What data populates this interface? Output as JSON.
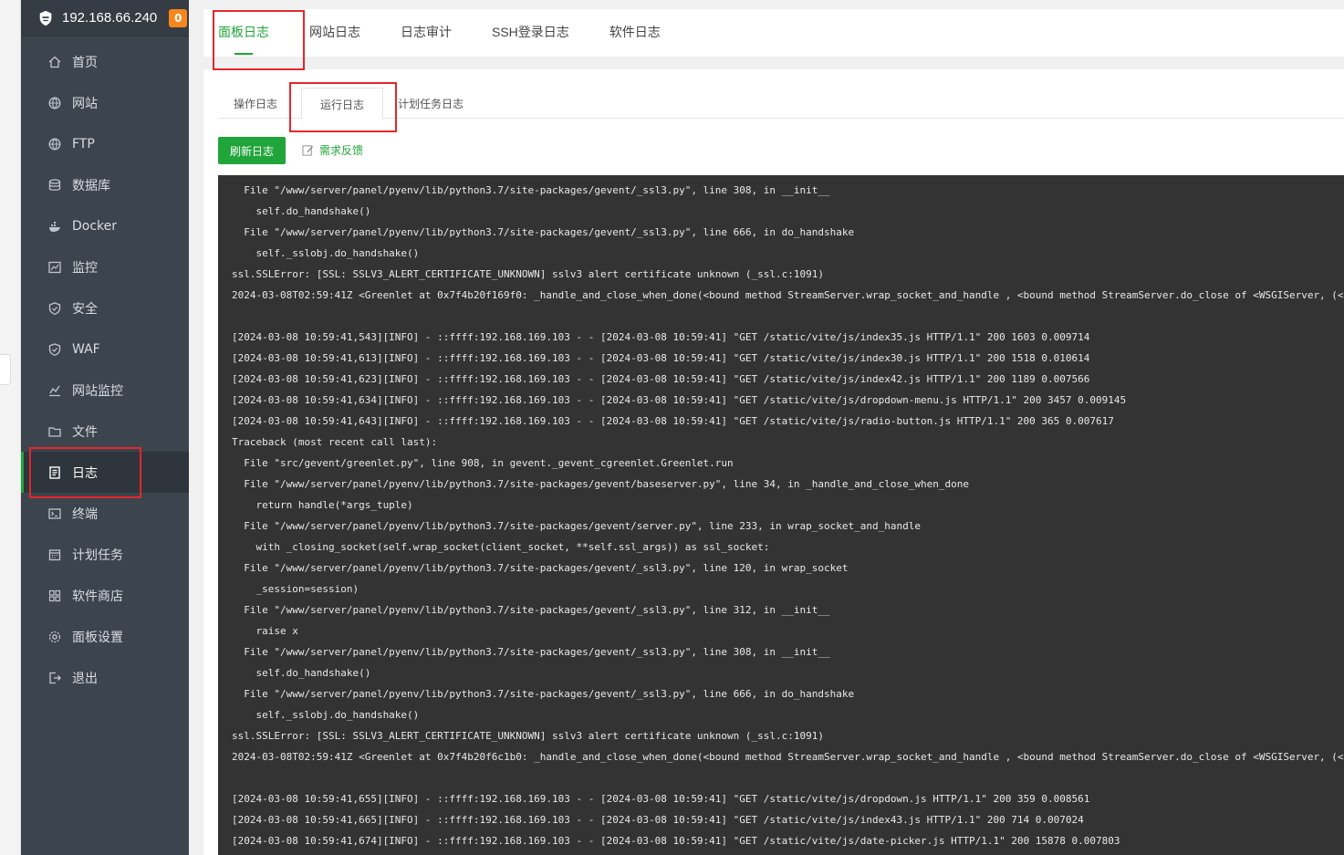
{
  "sidebar": {
    "server_ip": "192.168.66.240",
    "badge_count": "0",
    "items": [
      {
        "label": "首页",
        "icon": "home-icon"
      },
      {
        "label": "网站",
        "icon": "globe-icon"
      },
      {
        "label": "FTP",
        "icon": "globe-icon"
      },
      {
        "label": "数据库",
        "icon": "database-icon"
      },
      {
        "label": "Docker",
        "icon": "docker-icon"
      },
      {
        "label": "监控",
        "icon": "monitor-icon"
      },
      {
        "label": "安全",
        "icon": "shield-icon"
      },
      {
        "label": "WAF",
        "icon": "shield-icon"
      },
      {
        "label": "网站监控",
        "icon": "chart-icon"
      },
      {
        "label": "文件",
        "icon": "folder-icon"
      },
      {
        "label": "日志",
        "icon": "log-icon",
        "active": true
      },
      {
        "label": "终端",
        "icon": "terminal-icon"
      },
      {
        "label": "计划任务",
        "icon": "calendar-icon"
      },
      {
        "label": "软件商店",
        "icon": "apps-icon"
      },
      {
        "label": "面板设置",
        "icon": "gear-icon"
      },
      {
        "label": "退出",
        "icon": "logout-icon"
      }
    ]
  },
  "top_tabs": [
    "面板日志",
    "网站日志",
    "日志审计",
    "SSH登录日志",
    "软件日志"
  ],
  "sub_tabs": [
    "操作日志",
    "运行日志",
    "计划任务日志"
  ],
  "refresh_label": "刷新日志",
  "feedback_label": "需求反馈",
  "log_lines": [
    "  File \"/www/server/panel/pyenv/lib/python3.7/site-packages/gevent/_ssl3.py\", line 308, in __init__",
    "    self.do_handshake()",
    "  File \"/www/server/panel/pyenv/lib/python3.7/site-packages/gevent/_ssl3.py\", line 666, in do_handshake",
    "    self._sslobj.do_handshake()",
    "ssl.SSLError: [SSL: SSLV3_ALERT_CERTIFICATE_UNKNOWN] sslv3 alert certificate unknown (_ssl.c:1091)",
    "2024-03-08T02:59:41Z <Greenlet at 0x7f4b20f169f0: _handle_and_close_when_done(<bound method StreamServer.wrap_socket_and_handle , <bound method StreamServer.do_close of <WSGIServer, (<g",
    "",
    "[2024-03-08 10:59:41,543][INFO] - ::ffff:192.168.169.103 - - [2024-03-08 10:59:41] \"GET /static/vite/js/index35.js HTTP/1.1\" 200 1603 0.009714",
    "[2024-03-08 10:59:41,613][INFO] - ::ffff:192.168.169.103 - - [2024-03-08 10:59:41] \"GET /static/vite/js/index30.js HTTP/1.1\" 200 1518 0.010614",
    "[2024-03-08 10:59:41,623][INFO] - ::ffff:192.168.169.103 - - [2024-03-08 10:59:41] \"GET /static/vite/js/index42.js HTTP/1.1\" 200 1189 0.007566",
    "[2024-03-08 10:59:41,634][INFO] - ::ffff:192.168.169.103 - - [2024-03-08 10:59:41] \"GET /static/vite/js/dropdown-menu.js HTTP/1.1\" 200 3457 0.009145",
    "[2024-03-08 10:59:41,643][INFO] - ::ffff:192.168.169.103 - - [2024-03-08 10:59:41] \"GET /static/vite/js/radio-button.js HTTP/1.1\" 200 365 0.007617",
    "Traceback (most recent call last):",
    "  File \"src/gevent/greenlet.py\", line 908, in gevent._gevent_cgreenlet.Greenlet.run",
    "  File \"/www/server/panel/pyenv/lib/python3.7/site-packages/gevent/baseserver.py\", line 34, in _handle_and_close_when_done",
    "    return handle(*args_tuple)",
    "  File \"/www/server/panel/pyenv/lib/python3.7/site-packages/gevent/server.py\", line 233, in wrap_socket_and_handle",
    "    with _closing_socket(self.wrap_socket(client_socket, **self.ssl_args)) as ssl_socket:",
    "  File \"/www/server/panel/pyenv/lib/python3.7/site-packages/gevent/_ssl3.py\", line 120, in wrap_socket",
    "    _session=session)",
    "  File \"/www/server/panel/pyenv/lib/python3.7/site-packages/gevent/_ssl3.py\", line 312, in __init__",
    "    raise x",
    "  File \"/www/server/panel/pyenv/lib/python3.7/site-packages/gevent/_ssl3.py\", line 308, in __init__",
    "    self.do_handshake()",
    "  File \"/www/server/panel/pyenv/lib/python3.7/site-packages/gevent/_ssl3.py\", line 666, in do_handshake",
    "    self._sslobj.do_handshake()",
    "ssl.SSLError: [SSL: SSLV3_ALERT_CERTIFICATE_UNKNOWN] sslv3 alert certificate unknown (_ssl.c:1091)",
    "2024-03-08T02:59:41Z <Greenlet at 0x7f4b20f6c1b0: _handle_and_close_when_done(<bound method StreamServer.wrap_socket_and_handle , <bound method StreamServer.do_close of <WSGIServer, (<g",
    "",
    "[2024-03-08 10:59:41,655][INFO] - ::ffff:192.168.169.103 - - [2024-03-08 10:59:41] \"GET /static/vite/js/dropdown.js HTTP/1.1\" 200 359 0.008561",
    "[2024-03-08 10:59:41,665][INFO] - ::ffff:192.168.169.103 - - [2024-03-08 10:59:41] \"GET /static/vite/js/index43.js HTTP/1.1\" 200 714 0.007024",
    "[2024-03-08 10:59:41,674][INFO] - ::ffff:192.168.169.103 - - [2024-03-08 10:59:41] \"GET /static/vite/js/date-picker.js HTTP/1.1\" 200 15878 0.007803"
  ]
}
